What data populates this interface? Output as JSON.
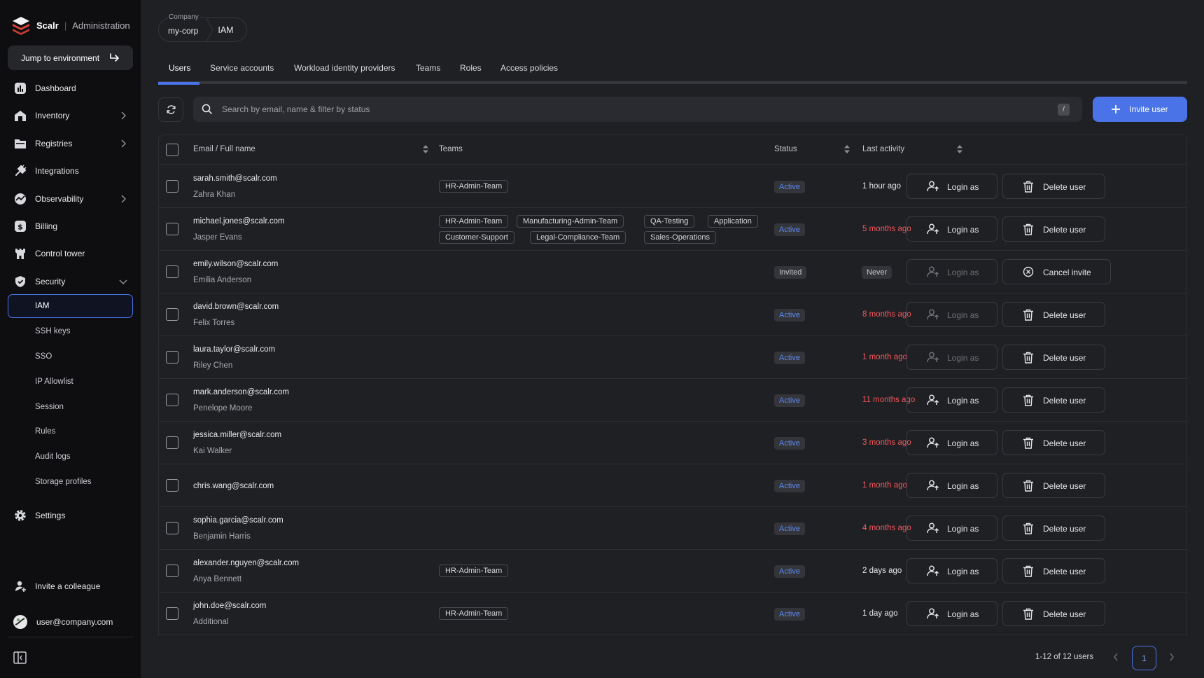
{
  "brand": {
    "name": "Scalr",
    "separator": "|",
    "area": "Administration"
  },
  "sidebar": {
    "jump_label": "Jump to environment",
    "items": [
      {
        "label": "Dashboard",
        "icon": "dashboard-icon",
        "has_chevron": false
      },
      {
        "label": "Inventory",
        "icon": "inventory-icon",
        "has_chevron": true
      },
      {
        "label": "Registries",
        "icon": "registries-icon",
        "has_chevron": true
      },
      {
        "label": "Integrations",
        "icon": "integrations-icon",
        "has_chevron": false
      },
      {
        "label": "Observability",
        "icon": "observability-icon",
        "has_chevron": true
      },
      {
        "label": "Billing",
        "icon": "billing-icon",
        "has_chevron": false
      },
      {
        "label": "Control tower",
        "icon": "control-tower-icon",
        "has_chevron": false
      },
      {
        "label": "Security",
        "icon": "security-icon",
        "has_chevron": true,
        "expanded": true
      }
    ],
    "security_sub": [
      "IAM",
      "SSH keys",
      "SSO",
      "IP Allowlist",
      "Session",
      "Rules",
      "Audit logs",
      "Storage profiles"
    ],
    "active_sub": "IAM",
    "settings_label": "Settings",
    "invite_colleague_label": "Invite a colleague",
    "user_email": "user@company.com"
  },
  "breadcrumb": {
    "company_label": "Company",
    "company_value": "my-corp",
    "current": "IAM"
  },
  "tabs": [
    "Users",
    "Service accounts",
    "Workload identity providers",
    "Teams",
    "Roles",
    "Access policies"
  ],
  "active_tab": "Users",
  "search": {
    "placeholder": "Search by email, name & filter by status",
    "shortcut": "/"
  },
  "invite_button": "Invite user",
  "table": {
    "headers": {
      "email": "Email / Full name",
      "teams": "Teams",
      "status": "Status",
      "activity": "Last activity"
    },
    "rows": [
      {
        "email": "sarah.smith@scalr.com",
        "name": "Zahra Khan",
        "teams": [
          [
            "HR-Admin-Team"
          ]
        ],
        "status": "Active",
        "activity": "1 hour ago",
        "activity_state": "normal",
        "login_enabled": true,
        "action": "Delete user"
      },
      {
        "email": "michael.jones@scalr.com",
        "name": "Jasper Evans",
        "teams": [
          [
            "HR-Admin-Team",
            "Manufacturing-Admin-Team",
            "QA-Testing",
            "Application"
          ],
          [
            "Customer-Support",
            "Legal-Compliance-Team",
            "Sales-Operations"
          ]
        ],
        "status": "Active",
        "activity": "5 months ago",
        "activity_state": "stale",
        "login_enabled": true,
        "action": "Delete user"
      },
      {
        "email": "emily.wilson@scalr.com",
        "name": "Emilia Anderson",
        "teams": [],
        "status": "Invited",
        "activity": "Never",
        "activity_state": "never",
        "login_enabled": false,
        "action": "Cancel invite"
      },
      {
        "email": "david.brown@scalr.com",
        "name": "Felix Torres",
        "teams": [],
        "status": "Active",
        "activity": "8 months ago",
        "activity_state": "stale",
        "login_enabled": false,
        "action": "Delete user"
      },
      {
        "email": "laura.taylor@scalr.com",
        "name": "Riley Chen",
        "teams": [],
        "status": "Active",
        "activity": "1 month ago",
        "activity_state": "stale",
        "login_enabled": false,
        "action": "Delete user"
      },
      {
        "email": "mark.anderson@scalr.com",
        "name": "Penelope Moore",
        "teams": [],
        "status": "Active",
        "activity": "11 months ago",
        "activity_state": "stale",
        "login_enabled": true,
        "action": "Delete user"
      },
      {
        "email": "jessica.miller@scalr.com",
        "name": "Kai Walker",
        "teams": [],
        "status": "Active",
        "activity": "3 months ago",
        "activity_state": "stale",
        "login_enabled": true,
        "action": "Delete user"
      },
      {
        "email": "chris.wang@scalr.com",
        "name": "",
        "teams": [],
        "status": "Active",
        "activity": "1 month ago",
        "activity_state": "stale",
        "login_enabled": true,
        "action": "Delete user"
      },
      {
        "email": "sophia.garcia@scalr.com",
        "name": "Benjamin Harris",
        "teams": [],
        "status": "Active",
        "activity": "4 months ago",
        "activity_state": "stale",
        "login_enabled": true,
        "action": "Delete user"
      },
      {
        "email": "alexander.nguyen@scalr.com",
        "name": "Anya Bennett",
        "teams": [
          [
            "HR-Admin-Team"
          ]
        ],
        "status": "Active",
        "activity": "2 days ago",
        "activity_state": "normal",
        "login_enabled": true,
        "action": "Delete user"
      },
      {
        "email": "john.doe@scalr.com",
        "name": "Additional",
        "teams": [
          [
            "HR-Admin-Team"
          ]
        ],
        "status": "Active",
        "activity": "1 day ago",
        "activity_state": "normal",
        "login_enabled": true,
        "action": "Delete user"
      }
    ],
    "login_label": "Login as"
  },
  "pagination": {
    "summary": "1-12 of 12 users",
    "current_page": "1"
  },
  "colors": {
    "accent": "#4b73e8",
    "stale": "#f0575a",
    "active": "#5b8af0"
  }
}
